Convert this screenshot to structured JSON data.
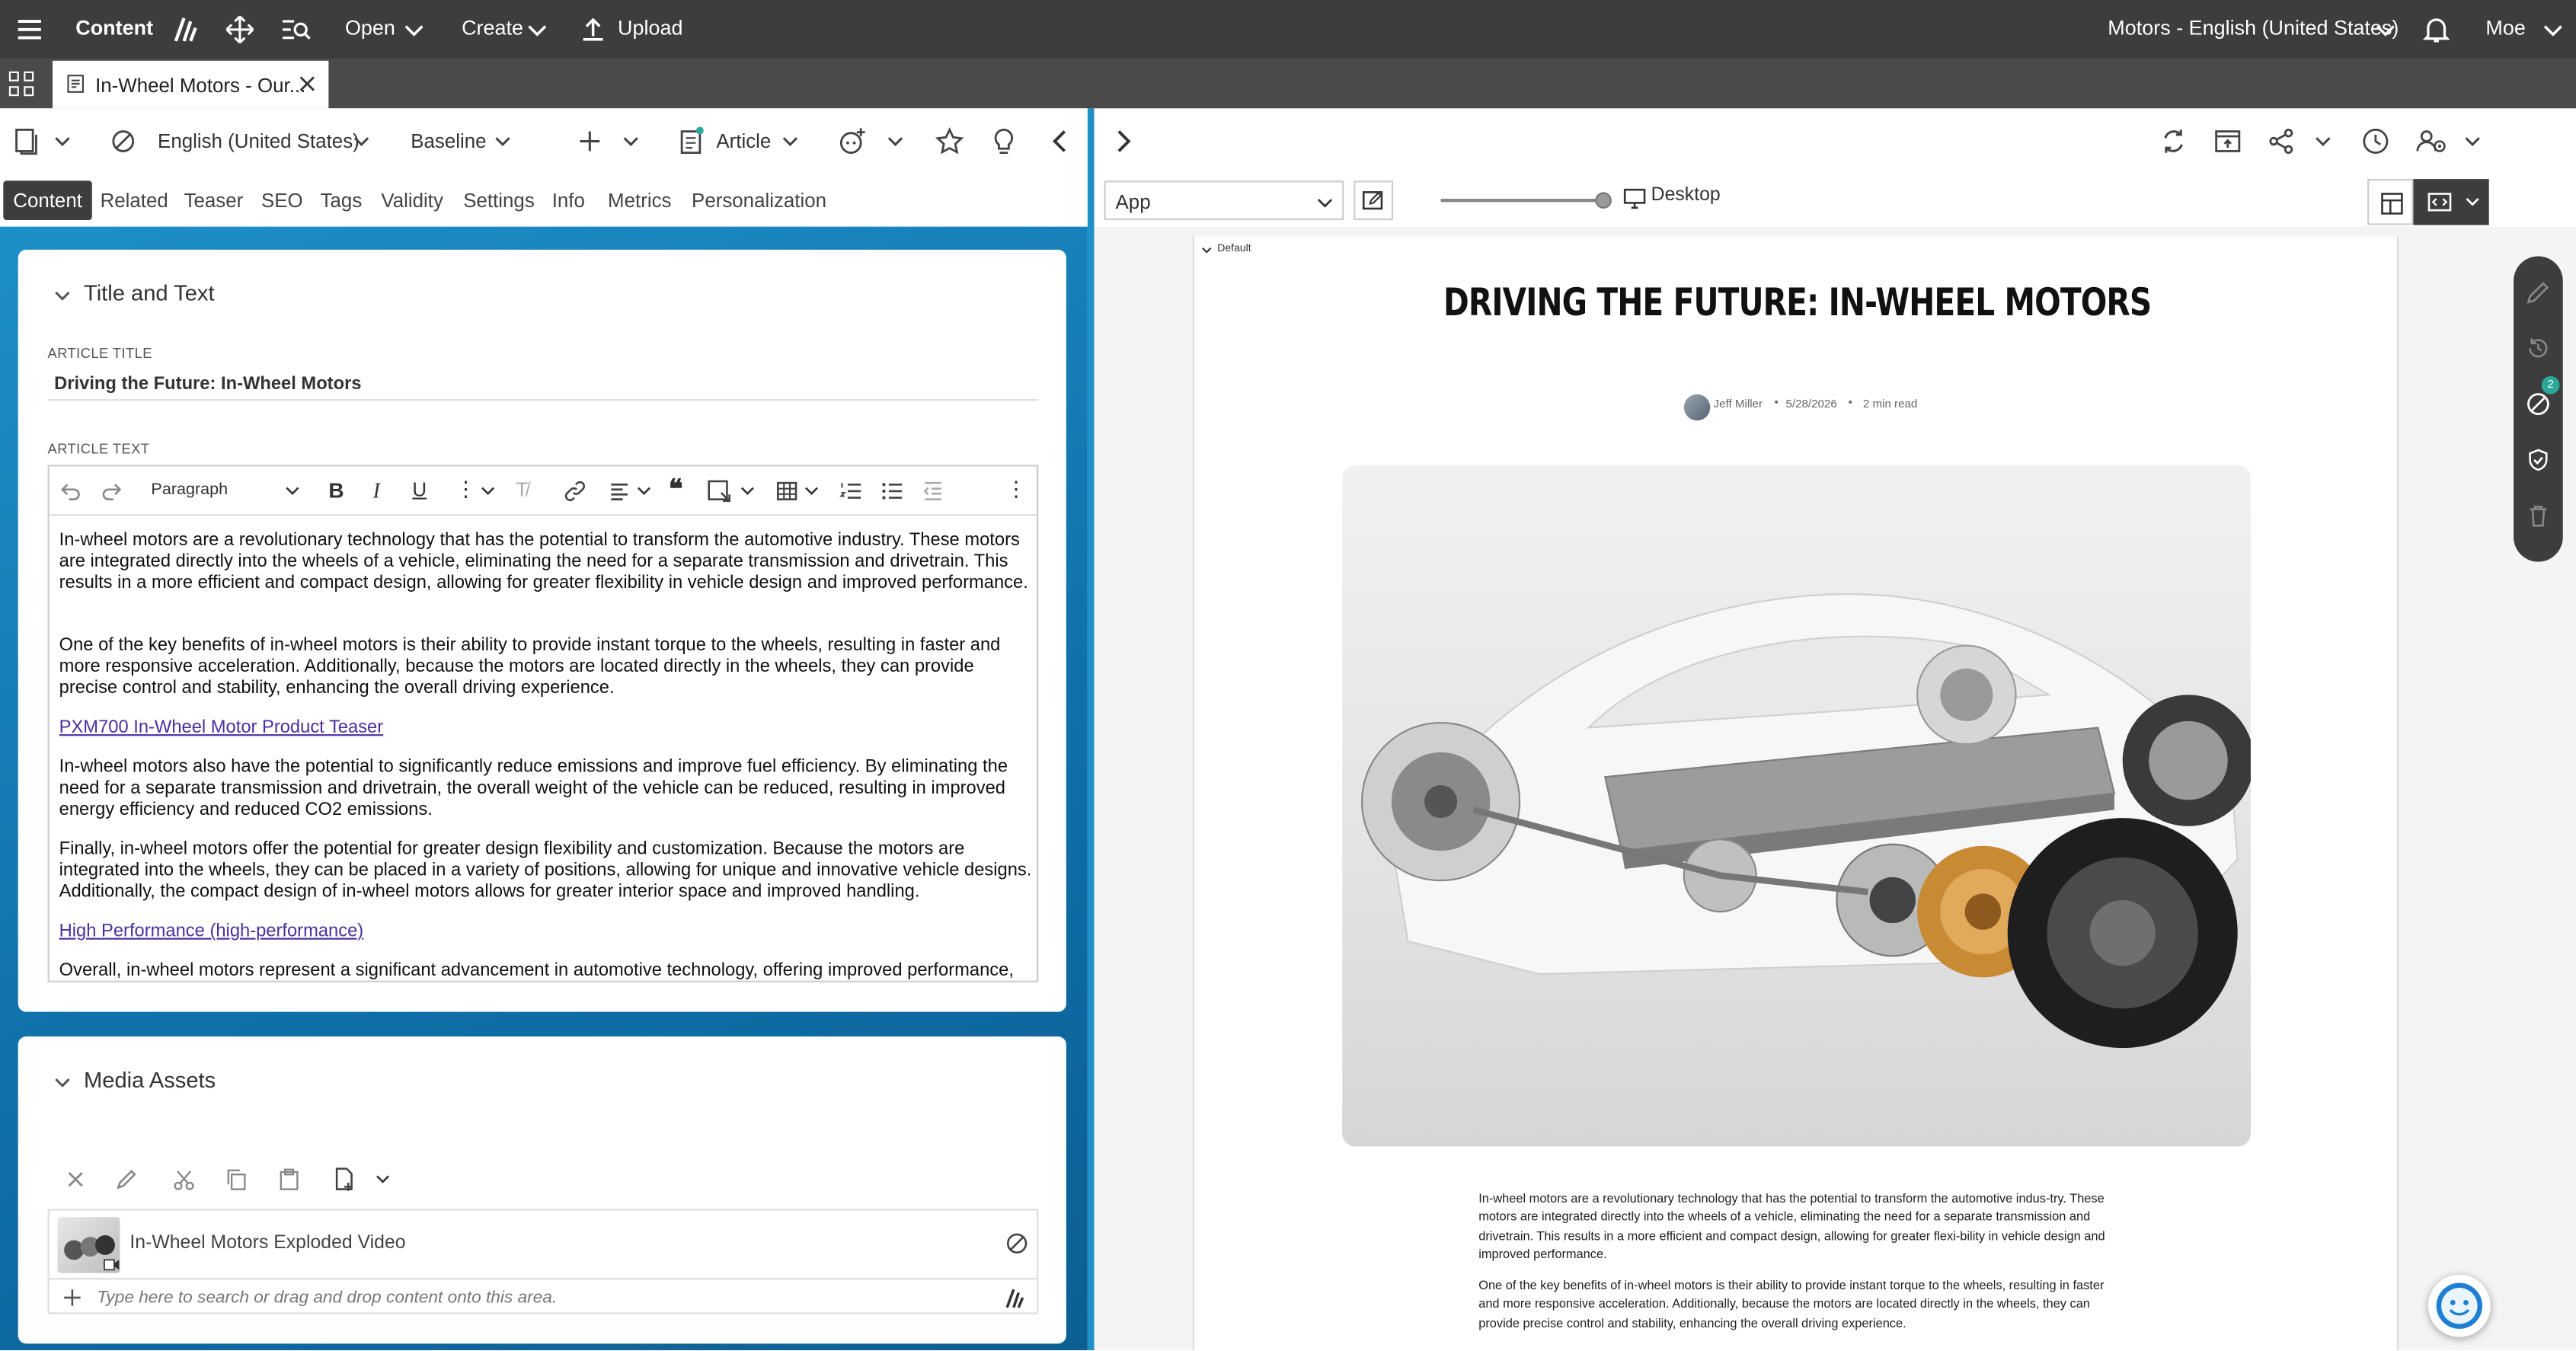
{
  "topbar": {
    "app_name": "Content",
    "open_label": "Open",
    "create_label": "Create",
    "upload_label": "Upload",
    "site_selector": "Motors - English (United States)",
    "user_name": "Moe"
  },
  "tabs": [
    {
      "label": "In-Wheel Motors - Our..."
    }
  ],
  "editor_toolbar": {
    "locale": "English (United States)",
    "workflow": "Baseline",
    "doc_type": "Article"
  },
  "form_tabs": [
    "Content",
    "Related",
    "Teaser",
    "SEO",
    "Tags",
    "Validity",
    "Settings",
    "Info",
    "Metrics",
    "Personalization"
  ],
  "title_section": {
    "heading": "Title and Text",
    "article_title_label": "ARTICLE TITLE",
    "article_title_value": "Driving the Future: In-Wheel Motors",
    "article_text_label": "ARTICLE TEXT",
    "paragraph_style": "Paragraph",
    "paragraphs": [
      "In-wheel motors are a revolutionary technology that has the potential to transform the automotive industry. These motors are integrated directly into the wheels of a vehicle, eliminating the need for a separate transmission and drivetrain. This results in a more efficient and compact design, allowing for greater flexibility in vehicle design and improved performance.",
      "One of the key benefits of in-wheel motors is their ability to provide instant torque to the wheels, resulting in faster and more responsive acceleration. Additionally, because the motors are located directly in the wheels, they can provide precise control and stability, enhancing the overall driving experience.",
      "PXM700 In-Wheel Motor Product Teaser",
      "In-wheel motors also have the potential to significantly reduce emissions and improve fuel efficiency. By eliminating the need for a separate transmission and drivetrain, the overall weight of the vehicle can be reduced, resulting in improved energy efficiency and reduced CO2 emissions.",
      "Finally, in-wheel motors offer the potential for greater design flexibility and customization. Because the motors are integrated into the wheels, they can be placed in a variety of positions, allowing for unique and innovative vehicle designs. Additionally, the compact design of in-wheel motors allows for greater interior space and improved handling.",
      "High Performance (high-performance)",
      "Overall, in-wheel motors represent a significant advancement in automotive technology, offering improved performance,"
    ]
  },
  "media_section": {
    "heading": "Media Assets",
    "item_label": "In-Wheel Motors Exploded Video",
    "search_placeholder": "Type here to search or drag and drop content onto this area."
  },
  "preview_toolbar": {
    "channel": "App",
    "device": "Desktop"
  },
  "preview": {
    "container_label": "Default",
    "headline": "DRIVING THE FUTURE: IN-WHEEL MOTORS",
    "author": "Jeff Miller",
    "date": "5/28/2026",
    "read_time": "2 min read",
    "body_1": "In-wheel motors are a revolutionary technology that has the potential to transform the automotive indus-try. These motors are integrated directly into the wheels of a vehicle, eliminating the need for a separate transmission and drivetrain. This results in a more efficient and compact design, allowing for greater flexi-bility in vehicle design and improved performance.",
    "body_2": "One of the key benefits of in-wheel motors is their ability to provide instant torque to the wheels, resulting in faster and more responsive acceleration. Additionally, because the motors are located directly in the wheels, they can provide precise control and stability, enhancing the overall driving experience."
  },
  "side_panel": {
    "badge_count": "2"
  },
  "colors": {
    "topbar": "#3d3d3d",
    "tabbar": "#4a4a4a",
    "accent_blue": "#1e8fc7",
    "link_purple": "#4b2fa0"
  }
}
